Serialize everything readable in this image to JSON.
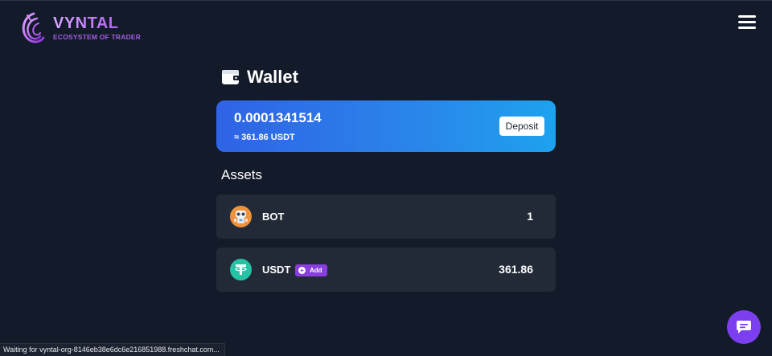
{
  "header": {
    "brand_name": "VYNTAL",
    "brand_tagline": "ECOSYSTEM OF TRADER",
    "menu_icon": "hamburger-menu-icon"
  },
  "wallet": {
    "title": "Wallet",
    "icon": "wallet-icon",
    "balance": "0.0001341514",
    "balance_usdt": "≈ 361.86 USDT",
    "deposit_label": "Deposit"
  },
  "assets": {
    "title": "Assets",
    "items": [
      {
        "name": "BOT",
        "value": "1",
        "icon": "bot-token-icon"
      },
      {
        "name": "USDT",
        "value": "361.86",
        "icon": "tether-icon",
        "badge": "Add"
      }
    ]
  },
  "chat": {
    "icon": "chat-bubble-icon"
  },
  "status_bar": {
    "text": "Waiting for vyntal-org-8146eb38e6dc6e216851988.freshchat.com..."
  },
  "colors": {
    "background": "#131a29",
    "card_gradient_start": "#2f63e6",
    "card_gradient_end": "#1ea2ee",
    "row_background": "#222a38",
    "brand_purple": "#a44cf0",
    "chat_purple": "#7c3ff0"
  }
}
